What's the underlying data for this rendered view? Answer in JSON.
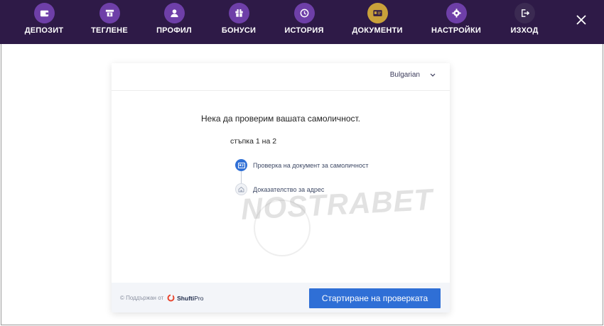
{
  "nav": {
    "items": [
      {
        "label": "ДЕПОЗИТ",
        "icon": "wallet-icon"
      },
      {
        "label": "ТЕГЛЕНЕ",
        "icon": "withdraw-icon"
      },
      {
        "label": "ПРОФИЛ",
        "icon": "user-icon"
      },
      {
        "label": "БОНУСИ",
        "icon": "gift-icon"
      },
      {
        "label": "ИСТОРИЯ",
        "icon": "clock-icon"
      },
      {
        "label": "ДОКУМЕНТИ",
        "icon": "id-card-icon",
        "active": true
      },
      {
        "label": "НАСТРОЙКИ",
        "icon": "gear-icon"
      },
      {
        "label": "ИЗХОД",
        "icon": "logout-icon"
      }
    ],
    "colors": {
      "bar": "#2e1a47",
      "icon_bg": "#6e3fa8",
      "active_bg": "#c9a13a"
    }
  },
  "card": {
    "language": "Bulgarian",
    "title": "Нека да проверим вашата самоличност.",
    "step_text": "стъпка 1 на 2",
    "steps": [
      {
        "label": "Проверка на документ за самоличност",
        "active": true
      },
      {
        "label": "Доказателство за адрес",
        "active": false
      }
    ],
    "watermark": "NOSTRABET",
    "footer": {
      "powered_by": "© Поддържан от",
      "brand_bold": "Shufti",
      "brand_light": "Pro",
      "start_button": "Стартиране на проверката"
    },
    "accent": "#2f6fd6"
  }
}
